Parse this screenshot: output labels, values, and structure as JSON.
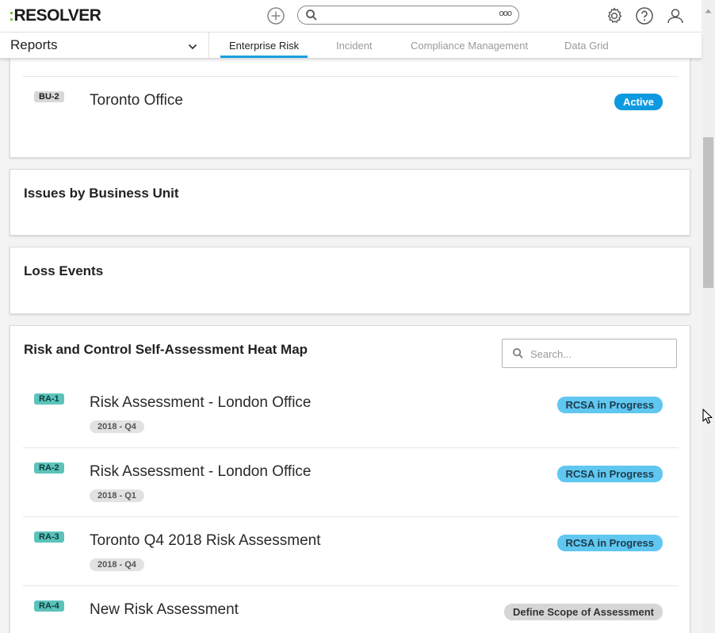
{
  "app": {
    "logo": "RESOLVER",
    "logo_prefix": ":"
  },
  "header": {
    "search_placeholder": "",
    "more_label": "ooo"
  },
  "nav": {
    "reports_label": "Reports",
    "tabs": [
      {
        "label": "Enterprise Risk",
        "active": true
      },
      {
        "label": "Incident",
        "active": false
      },
      {
        "label": "Compliance Management",
        "active": false
      },
      {
        "label": "Data Grid",
        "active": false
      }
    ]
  },
  "business_units": {
    "rows": [
      {
        "code": "BU-2",
        "name": "Toronto Office",
        "status": "Active"
      }
    ]
  },
  "issues_card": {
    "title": "Issues by Business Unit"
  },
  "loss_card": {
    "title": "Loss Events"
  },
  "rcsa_card": {
    "title": "Risk and Control Self-Assessment Heat Map",
    "search_placeholder": "Search...",
    "rows": [
      {
        "code": "RA-1",
        "name": "Risk Assessment - London Office",
        "period": "2018 - Q4",
        "status": "RCSA in Progress"
      },
      {
        "code": "RA-2",
        "name": "Risk Assessment - London Office",
        "period": "2018 - Q1",
        "status": "RCSA in Progress"
      },
      {
        "code": "RA-3",
        "name": "Toronto Q4 2018 Risk Assessment",
        "period": "2018 - Q4",
        "status": "RCSA in Progress"
      },
      {
        "code": "RA-4",
        "name": "New Risk Assessment",
        "period": "",
        "status": "Define Scope of Assessment"
      }
    ]
  },
  "colors": {
    "accent": "#1aa0e0",
    "active_status": "#0e9ae0",
    "rcsa_status": "#5fc7f0",
    "teal_badge": "#5cc3bc",
    "logo_dots": "#74c043"
  }
}
